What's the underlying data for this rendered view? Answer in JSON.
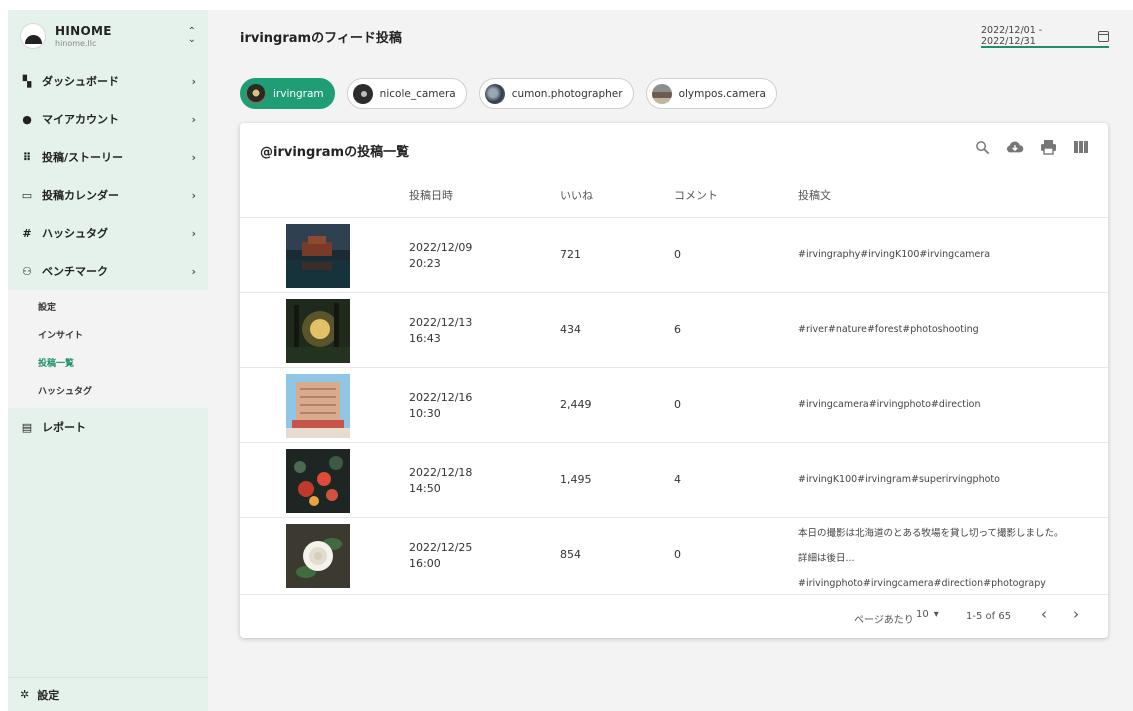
{
  "brand": {
    "name": "HINOME",
    "domain": "hinome.llc",
    "switch_icon": "unfold-icon"
  },
  "sidebar": {
    "items": [
      {
        "label": "ダッシュボード",
        "icon": "dashboard-icon"
      },
      {
        "label": "マイアカウント",
        "icon": "account-circle-icon"
      },
      {
        "label": "投稿/ストーリー",
        "icon": "grid-icon"
      },
      {
        "label": "投稿カレンダー",
        "icon": "calendar-icon"
      },
      {
        "label": "ハッシュタグ",
        "icon": "hashtag-icon"
      },
      {
        "label": "ベンチマーク",
        "icon": "people-icon"
      }
    ],
    "benchmark_sub": [
      {
        "label": "設定"
      },
      {
        "label": "インサイト"
      },
      {
        "label": "投稿一覧",
        "active": true
      },
      {
        "label": "ハッシュタグ"
      }
    ],
    "report": {
      "label": "レポート",
      "icon": "document-icon"
    },
    "footer": {
      "label": "設定",
      "icon": "gear-icon"
    }
  },
  "header": {
    "title": "irvingramのフィード投稿",
    "date_range": "2022/12/01 - 2022/12/31"
  },
  "accounts": [
    {
      "name": "irvingram",
      "active": true
    },
    {
      "name": "nicole_camera"
    },
    {
      "name": "cumon.photographer"
    },
    {
      "name": "olympos.camera"
    }
  ],
  "table": {
    "title": "@irvingramの投稿一覧",
    "tools": [
      "search-icon",
      "cloud-download-icon",
      "print-icon",
      "columns-icon"
    ],
    "columns": {
      "date": "投稿日時",
      "likes": "いいね",
      "comments": "コメント",
      "text": "投稿文"
    },
    "rows": [
      {
        "date": "2022/12/09",
        "time": "20:23",
        "likes": "721",
        "comments": "0",
        "text_lines": [
          "#irvingraphy#irvingK100#irvingcamera"
        ]
      },
      {
        "date": "2022/12/13",
        "time": "16:43",
        "likes": "434",
        "comments": "6",
        "text_lines": [
          "#river#nature#forest#photoshooting"
        ]
      },
      {
        "date": "2022/12/16",
        "time": "10:30",
        "likes": "2,449",
        "comments": "0",
        "text_lines": [
          "#irvingcamera#irvingphoto#direction"
        ]
      },
      {
        "date": "2022/12/18",
        "time": "14:50",
        "likes": "1,495",
        "comments": "4",
        "text_lines": [
          "#irvingK100#irvingram#superirvingphoto"
        ]
      },
      {
        "date": "2022/12/25",
        "time": "16:00",
        "likes": "854",
        "comments": "0",
        "text_lines": [
          "本日の撮影は北海道のとある牧場を貸し切って撮影しました。",
          "詳細は後日...",
          "#irivingphoto#irvingcamera#direction#photograpy"
        ]
      }
    ],
    "pagination": {
      "per_page_label": "ページあたり",
      "per_page": "10",
      "range": "1-5 of 65"
    }
  },
  "colors": {
    "accent": "#1f9e76",
    "sidebar_bg": "#e4f2eb",
    "active_sub": "#1f8f6b"
  }
}
